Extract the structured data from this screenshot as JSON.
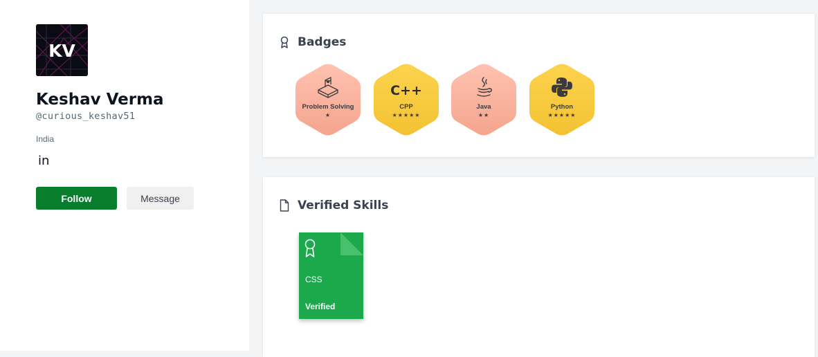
{
  "profile": {
    "avatar_initials": "KV",
    "name": "Keshav Verma",
    "handle": "@curious_keshav51",
    "country": "India",
    "linkedin_label": "in",
    "follow_label": "Follow",
    "message_label": "Message"
  },
  "badges_section": {
    "title": "Badges",
    "icon": "ribbon-icon",
    "items": [
      {
        "name": "Problem Solving",
        "stars": "★",
        "star_count": 1,
        "tier": "bronze",
        "icon": "problem-solving-icon"
      },
      {
        "name": "CPP",
        "stars": "★★★★★",
        "star_count": 5,
        "tier": "gold",
        "icon": "cpp-icon",
        "icon_text": "C++"
      },
      {
        "name": "Java",
        "stars": "★★",
        "star_count": 2,
        "tier": "bronze",
        "icon": "java-icon"
      },
      {
        "name": "Python",
        "stars": "★★★★★",
        "star_count": 5,
        "tier": "gold",
        "icon": "python-icon"
      }
    ]
  },
  "skills_section": {
    "title": "Verified Skills",
    "icon": "document-icon",
    "items": [
      {
        "name": "CSS",
        "status": "Verified",
        "icon": "award-ribbon-icon"
      }
    ]
  },
  "colors": {
    "primary_green": "#087d2b",
    "skill_green": "#1ba94c",
    "bronze_top": "#ffc2b0",
    "bronze_bottom": "#f4a58d",
    "gold_top": "#fcd34d",
    "gold_bottom": "#f3c233"
  }
}
